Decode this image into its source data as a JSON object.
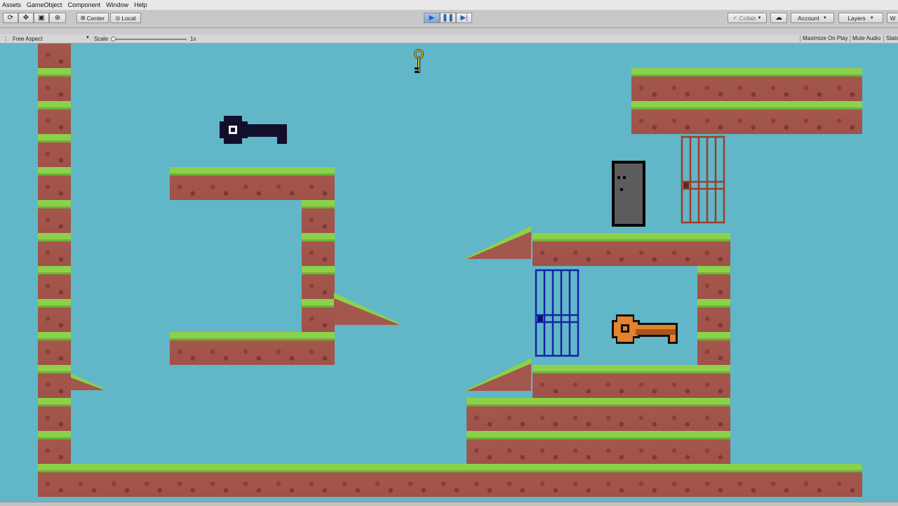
{
  "menu": [
    "Assets",
    "GameObject",
    "Component",
    "Window",
    "Help"
  ],
  "toolbar": {
    "pivot_center": "Center",
    "pivot_local": "Local",
    "collab": "Collab",
    "account": "Account",
    "layers": "Layers",
    "layout_initial": "W"
  },
  "game_view": {
    "aspect": "Free Aspect",
    "scale_label": "Scale",
    "scale_value": "1x",
    "maximize": "Maximize On Play",
    "mute": "Mute Audio",
    "stats": "Stats"
  },
  "colors": {
    "sky": "#61b7c7",
    "black_key": "#120f2b",
    "orange_key": "#e4832d",
    "blue_door": "#1521a8",
    "red_door": "#9c3e2b",
    "grey_door": "#5a5a5a",
    "small_key": "#e8c23a"
  },
  "icons": [
    "refresh-icon",
    "move-icon",
    "rect-tool-icon",
    "transform-icon",
    "play-icon",
    "pause-icon",
    "step-icon",
    "cloud-icon"
  ]
}
